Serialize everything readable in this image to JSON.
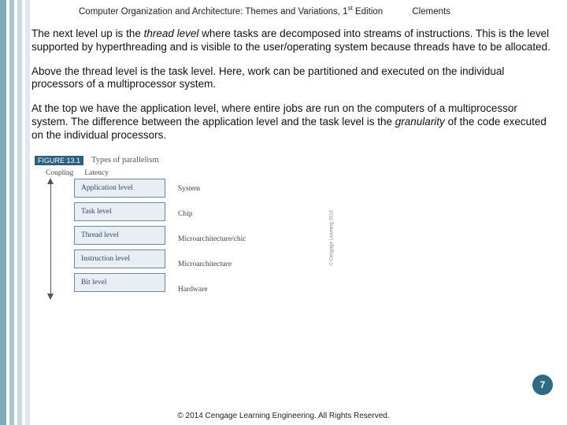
{
  "header": {
    "title_pre": "Computer Organization and Architecture: Themes and Variations, 1",
    "title_sup": "st",
    "title_post": " Edition",
    "author": "Clements"
  },
  "paragraphs": {
    "p1a": "The next level up is the ",
    "p1b": "thread level",
    "p1c": " where tasks are decomposed into streams of instructions. This is the level supported by hyperthreading and is visible to the user/operating system because threads have to be allocated.",
    "p2": "Above the thread level is the task level. Here, work can be partitioned and executed on the individual processors of a multiprocessor system.",
    "p3a": "At the top we have the application level, where entire jobs are run on the computers of a multiprocessor system. The difference between the application level and the task level is the ",
    "p3b": "granularity",
    "p3c": " of the code executed on the individual processors."
  },
  "figure": {
    "badge": "FIGURE 13.1",
    "title": "Types of parallelism",
    "axis_left": "Coupling",
    "axis_right": "Latency",
    "levels": [
      {
        "name": "Application level",
        "assoc": "System"
      },
      {
        "name": "Task level",
        "assoc": "Chip"
      },
      {
        "name": "Thread level",
        "assoc": "Microarchitecture/chic"
      },
      {
        "name": "Instruction level",
        "assoc": "Microarchitecture"
      },
      {
        "name": "Bit level",
        "assoc": "Hardware"
      }
    ],
    "side_copyright": "© Cengage Learning 2014"
  },
  "page_number": "7",
  "footer": "© 2014 Cengage Learning Engineering. All Rights Reserved."
}
